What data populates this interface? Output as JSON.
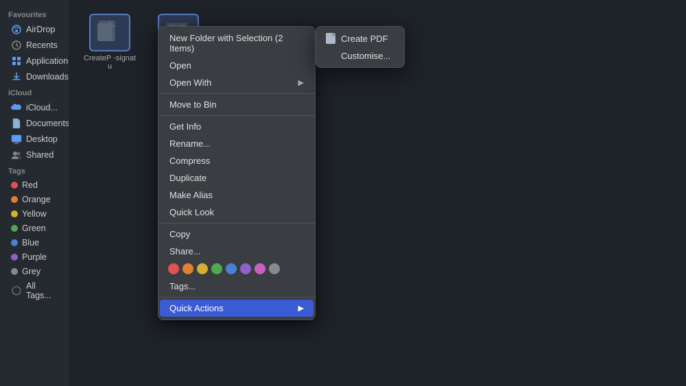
{
  "sidebar": {
    "sections": [
      {
        "title": "Favourites",
        "items": [
          {
            "id": "airdrop",
            "label": "AirDrop",
            "icon": "📡"
          },
          {
            "id": "recents",
            "label": "Recents",
            "icon": "🕐"
          },
          {
            "id": "applications",
            "label": "Applications",
            "icon": "📁"
          },
          {
            "id": "downloads",
            "label": "Downloads",
            "icon": "⬇"
          }
        ]
      },
      {
        "title": "iCloud",
        "items": [
          {
            "id": "icloud-drive",
            "label": "iCloud...",
            "icon": "☁"
          },
          {
            "id": "documents",
            "label": "Documents",
            "icon": "📄"
          },
          {
            "id": "desktop",
            "label": "Desktop",
            "icon": "🖥"
          },
          {
            "id": "shared",
            "label": "Shared",
            "icon": "👥"
          }
        ]
      },
      {
        "title": "Tags",
        "items": [
          {
            "id": "red",
            "label": "Red",
            "color": "#e05252"
          },
          {
            "id": "orange",
            "label": "Orange",
            "color": "#e08030"
          },
          {
            "id": "yellow",
            "label": "Yellow",
            "color": "#d4b030"
          },
          {
            "id": "green",
            "label": "Green",
            "color": "#50a850"
          },
          {
            "id": "blue",
            "label": "Blue",
            "color": "#4a80d4"
          },
          {
            "id": "purple",
            "label": "Purple",
            "color": "#9060c8"
          },
          {
            "id": "grey",
            "label": "Grey",
            "color": "#888890"
          },
          {
            "id": "all-tags",
            "label": "All Tags...",
            "color": null
          }
        ]
      }
    ]
  },
  "files": [
    {
      "id": "file1",
      "label": "CreateP\n-signatu",
      "selected": true
    },
    {
      "id": "file2",
      "label": "",
      "selected": true
    }
  ],
  "context_menu": {
    "items": [
      {
        "id": "new-folder",
        "label": "New Folder with Selection (2 Items)",
        "type": "item",
        "has_submenu": false
      },
      {
        "id": "open",
        "label": "Open",
        "type": "item",
        "has_submenu": false
      },
      {
        "id": "open-with",
        "label": "Open With",
        "type": "item",
        "has_submenu": true
      },
      {
        "id": "sep1",
        "type": "separator"
      },
      {
        "id": "move-to-bin",
        "label": "Move to Bin",
        "type": "item",
        "has_submenu": false
      },
      {
        "id": "sep2",
        "type": "separator"
      },
      {
        "id": "get-info",
        "label": "Get Info",
        "type": "item",
        "has_submenu": false
      },
      {
        "id": "rename",
        "label": "Rename...",
        "type": "item",
        "has_submenu": false
      },
      {
        "id": "compress",
        "label": "Compress",
        "type": "item",
        "has_submenu": false
      },
      {
        "id": "duplicate",
        "label": "Duplicate",
        "type": "item",
        "has_submenu": false
      },
      {
        "id": "make-alias",
        "label": "Make Alias",
        "type": "item",
        "has_submenu": false
      },
      {
        "id": "quick-look",
        "label": "Quick Look",
        "type": "item",
        "has_submenu": false
      },
      {
        "id": "sep3",
        "type": "separator"
      },
      {
        "id": "copy",
        "label": "Copy",
        "type": "item",
        "has_submenu": false
      },
      {
        "id": "share",
        "label": "Share...",
        "type": "item",
        "has_submenu": false
      },
      {
        "id": "tags-row",
        "type": "tags"
      },
      {
        "id": "tags-text",
        "label": "Tags...",
        "type": "item",
        "has_submenu": false
      },
      {
        "id": "sep4",
        "type": "separator"
      },
      {
        "id": "quick-actions",
        "label": "Quick Actions",
        "type": "item",
        "has_submenu": true,
        "highlighted": true
      }
    ],
    "tag_colors": [
      "#e05252",
      "#e08030",
      "#d4b030",
      "#50a850",
      "#4a80d4",
      "#9060c8",
      "#c860c0",
      "#888890"
    ]
  },
  "submenu": {
    "items": [
      {
        "id": "create-pdf",
        "label": "Create PDF",
        "has_icon": true
      },
      {
        "id": "customise",
        "label": "Customise...",
        "has_icon": false
      }
    ]
  }
}
